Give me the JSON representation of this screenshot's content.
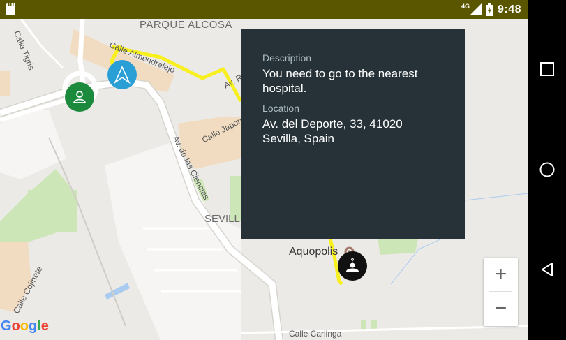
{
  "status_bar": {
    "time": "9:48",
    "network": "4G",
    "icons": [
      "sd-card-icon",
      "signal-icon",
      "battery-icon"
    ]
  },
  "map": {
    "labels": {
      "parque": "PARQUE ALCOSA",
      "sevilla": "SEVILL",
      "aquopolis": "Aquopolis",
      "calle_tigris": "Calle Tigris",
      "calle_almendralejo": "Calle Almendralejo",
      "av_r": "Av. R",
      "calle_japon": "Calle Japon",
      "av_ciencias": "Av. de las Ciencias",
      "calle_cojinete": "Calle Cojinete",
      "calle_carlinga": "Calle Carlinga"
    },
    "route_color": "#f7f01e",
    "zoom_in_label": "+",
    "zoom_out_label": "−",
    "attribution": [
      "G",
      "o",
      "o",
      "g",
      "l",
      "e"
    ]
  },
  "info_panel": {
    "description_label": "Description",
    "description_value": "You need to go to the nearest hospital.",
    "location_label": "Location",
    "location_value": "Av. del Deporte, 33, 41020 Sevilla, Spain"
  },
  "colors": {
    "status_bar": "#5a5600",
    "panel_bg": "#263238",
    "marker_green": "#1b8a3c",
    "marker_blue": "#2a9fd6",
    "marker_dark": "#111111"
  }
}
